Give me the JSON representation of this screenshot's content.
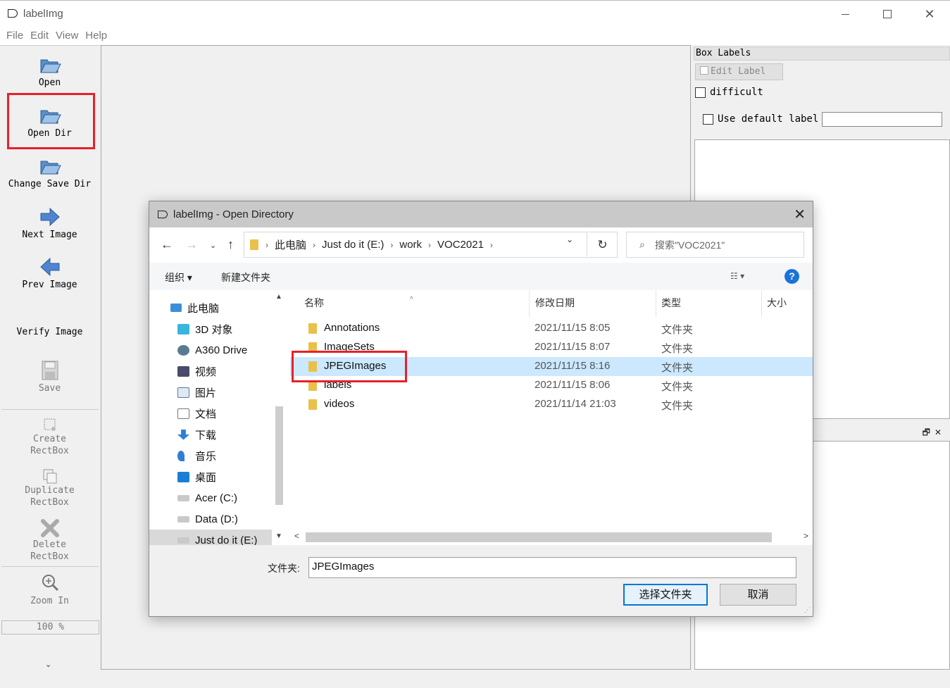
{
  "window": {
    "title": "labelImg",
    "close_glyph": "✕"
  },
  "menu": [
    "File",
    "Edit",
    "View",
    "Help"
  ],
  "toolbar": {
    "open": "Open",
    "open_dir": "Open Dir",
    "change_save_dir": "Change Save Dir",
    "next_image": "Next Image",
    "prev_image": "Prev Image",
    "verify_image": "Verify Image",
    "save": "Save",
    "create_rectbox": [
      "Create",
      "RectBox"
    ],
    "duplicate_rectbox": [
      "Duplicate",
      "RectBox"
    ],
    "delete_rectbox": [
      "Delete",
      "RectBox"
    ],
    "zoom_in": "Zoom In",
    "zoom_value": "100 %",
    "expand_glyph": "⌄"
  },
  "right_dock": {
    "box_labels_title": "Box Labels",
    "edit_label": "Edit Label",
    "difficult": "difficult",
    "use_default_label": "Use default label",
    "default_label_value": "",
    "dock_buttons": "🗗✕"
  },
  "dialog": {
    "title": "labelImg - Open Directory",
    "close_glyph": "✕",
    "nav": {
      "back": "←",
      "forward": "→",
      "recent": "⌄",
      "up": "↑",
      "refresh": "↻",
      "dropdown": "⌄"
    },
    "breadcrumbs": [
      "此电脑",
      "Just do it (E:)",
      "work",
      "VOC2021"
    ],
    "breadcrumb_sep": "›",
    "search_placeholder": "搜索\"VOC2021\"",
    "search_icon": "⌕",
    "organize": "组织 ▾",
    "new_folder": "新建文件夹",
    "view_glyph": "☷ ▾",
    "help_glyph": "?",
    "nav_tree": [
      {
        "label": "此电脑",
        "icon": "computer-icon"
      },
      {
        "label": "3D 对象",
        "icon": "cube-icon"
      },
      {
        "label": "A360 Drive",
        "icon": "cloud-drive-icon"
      },
      {
        "label": "视频",
        "icon": "video-icon"
      },
      {
        "label": "图片",
        "icon": "picture-icon"
      },
      {
        "label": "文档",
        "icon": "document-icon"
      },
      {
        "label": "下载",
        "icon": "download-icon"
      },
      {
        "label": "音乐",
        "icon": "music-icon"
      },
      {
        "label": "桌面",
        "icon": "desktop-icon"
      },
      {
        "label": "Acer (C:)",
        "icon": "drive-icon"
      },
      {
        "label": "Data (D:)",
        "icon": "drive-icon"
      },
      {
        "label": "Just do it (E:)",
        "icon": "drive-icon"
      }
    ],
    "columns": {
      "name": "名称",
      "date": "修改日期",
      "type": "类型",
      "size": "大小"
    },
    "files": [
      {
        "name": "Annotations",
        "date": "2021/11/15 8:05",
        "type": "文件夹"
      },
      {
        "name": "ImageSets",
        "date": "2021/11/15 8:07",
        "type": "文件夹"
      },
      {
        "name": "JPEGImages",
        "date": "2021/11/15 8:16",
        "type": "文件夹",
        "selected": true
      },
      {
        "name": "labels",
        "date": "2021/11/15 8:06",
        "type": "文件夹"
      },
      {
        "name": "videos",
        "date": "2021/11/14 21:03",
        "type": "文件夹"
      }
    ],
    "folder_label": "文件夹:",
    "folder_value": "JPEGImages",
    "select_folder": "选择文件夹",
    "cancel": "取消"
  }
}
